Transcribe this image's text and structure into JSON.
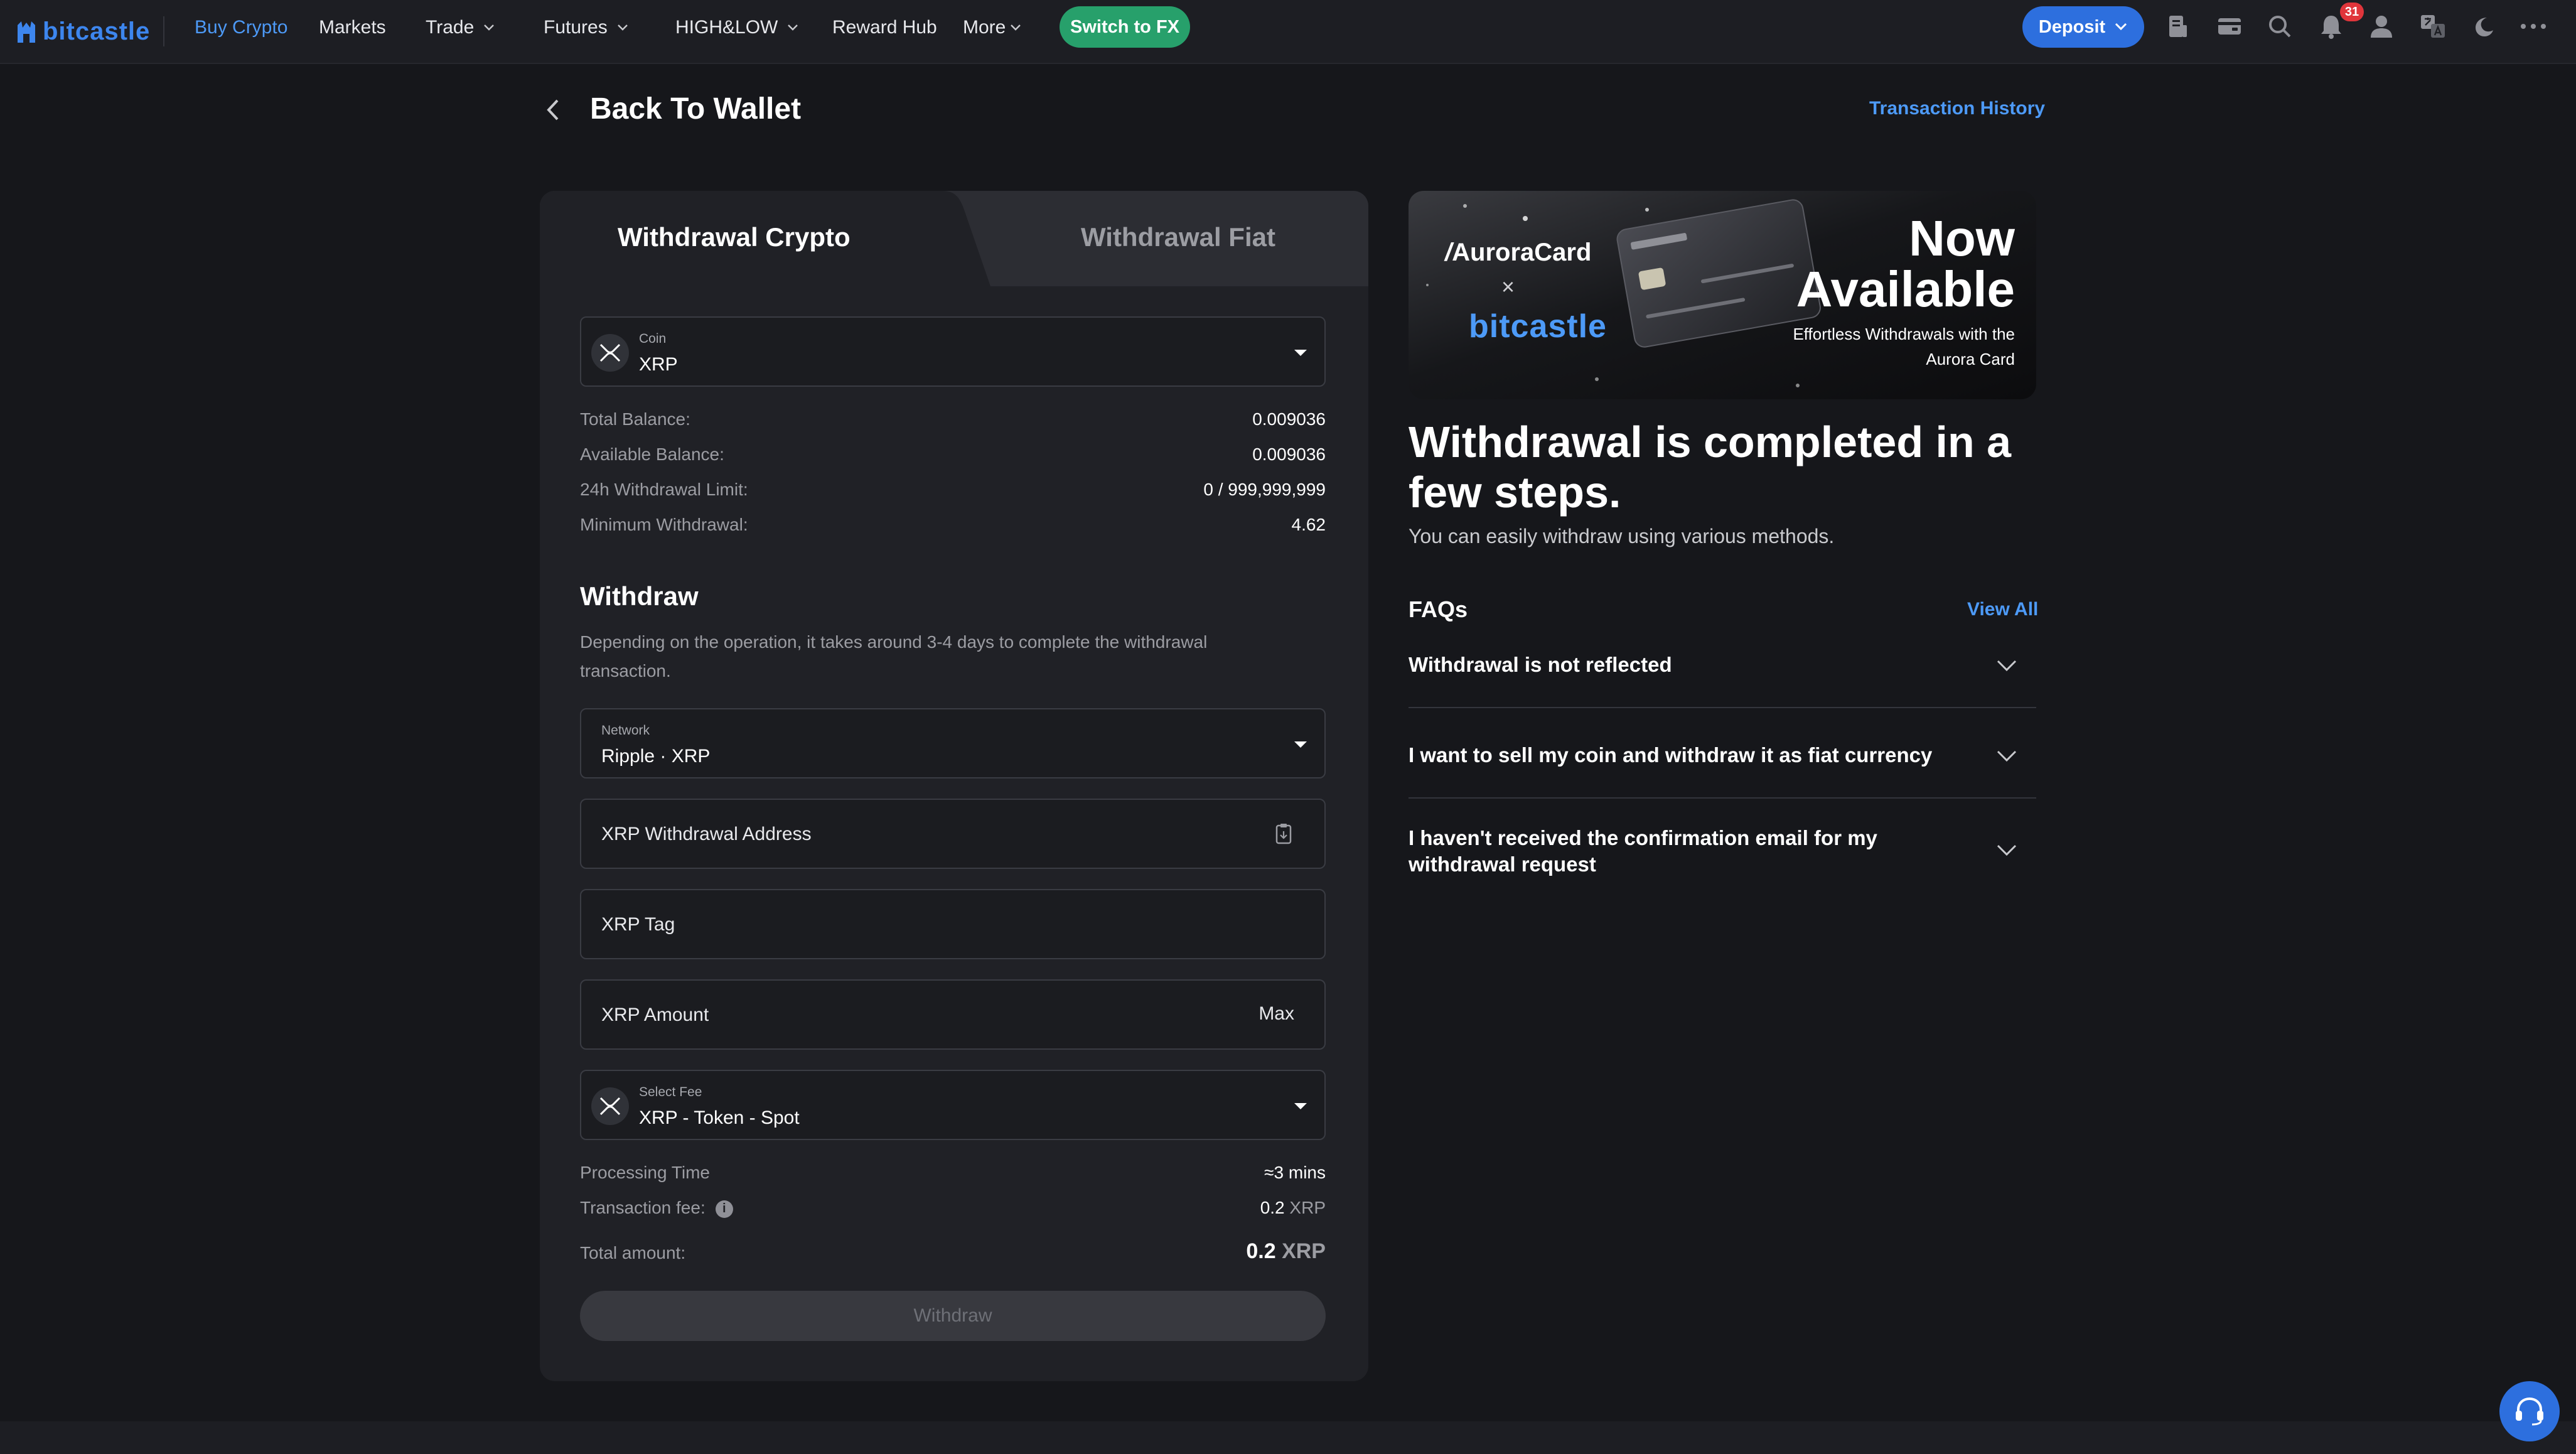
{
  "header": {
    "logo": "bitcastle",
    "nav": [
      {
        "label": "Buy Crypto"
      },
      {
        "label": "Markets"
      },
      {
        "label": "Trade"
      },
      {
        "label": "Futures"
      },
      {
        "label": "HIGH&LOW"
      },
      {
        "label": "Reward Hub"
      },
      {
        "label": "More"
      }
    ],
    "switch_fx": "Switch to FX",
    "deposit": "Deposit",
    "notification_count": "31",
    "icons": [
      "orders-icon",
      "wallet-icon",
      "search-icon",
      "bell-icon",
      "user-icon",
      "translate-icon",
      "moon-icon",
      "more-icon"
    ]
  },
  "page": {
    "back_title": "Back To Wallet",
    "transaction_history": "Transaction History"
  },
  "tabs": {
    "crypto": "Withdrawal Crypto",
    "fiat": "Withdrawal Fiat"
  },
  "coin": {
    "label": "Coin",
    "value": "XRP"
  },
  "balances": [
    {
      "label": "Total Balance:",
      "value": "0.009036"
    },
    {
      "label": "Available Balance:",
      "value": "0.009036"
    },
    {
      "label": "24h Withdrawal Limit:",
      "value": "0 / 999,999,999"
    },
    {
      "label": "Minimum Withdrawal:",
      "value": "4.62"
    }
  ],
  "withdraw": {
    "title": "Withdraw",
    "description": "Depending on the operation, it takes around 3-4 days to complete the withdrawal transaction.",
    "network_label": "Network",
    "network_value": "Ripple · XRP",
    "address_placeholder": "XRP Withdrawal Address",
    "tag_placeholder": "XRP Tag",
    "amount_placeholder": "XRP Amount",
    "max_label": "Max",
    "fee_label": "Select Fee",
    "fee_value": "XRP - Token - Spot",
    "processing_time_label": "Processing Time",
    "processing_time_value": "≈3 mins",
    "tx_fee_label": "Transaction fee:",
    "tx_fee_value": "0.2",
    "tx_fee_unit": "XRP",
    "total_label": "Total amount:",
    "total_value": "0.2",
    "total_unit": "XRP",
    "button": "Withdraw"
  },
  "banner": {
    "brand1": "AuroraCard",
    "x": "×",
    "brand2": "bitcastle",
    "now": "Now",
    "available": "Available",
    "sub": "Effortless Withdrawals with the Aurora Card"
  },
  "info": {
    "title": "Withdrawal is completed in a few steps.",
    "subtitle": "You can easily withdraw using various methods."
  },
  "faqs": {
    "title": "FAQs",
    "view_all": "View All",
    "items": [
      {
        "q": "Withdrawal is not reflected"
      },
      {
        "q": "I want to sell my coin and withdraw it as fiat currency"
      },
      {
        "q": "I haven't received the confirmation email for my withdrawal request"
      }
    ]
  }
}
